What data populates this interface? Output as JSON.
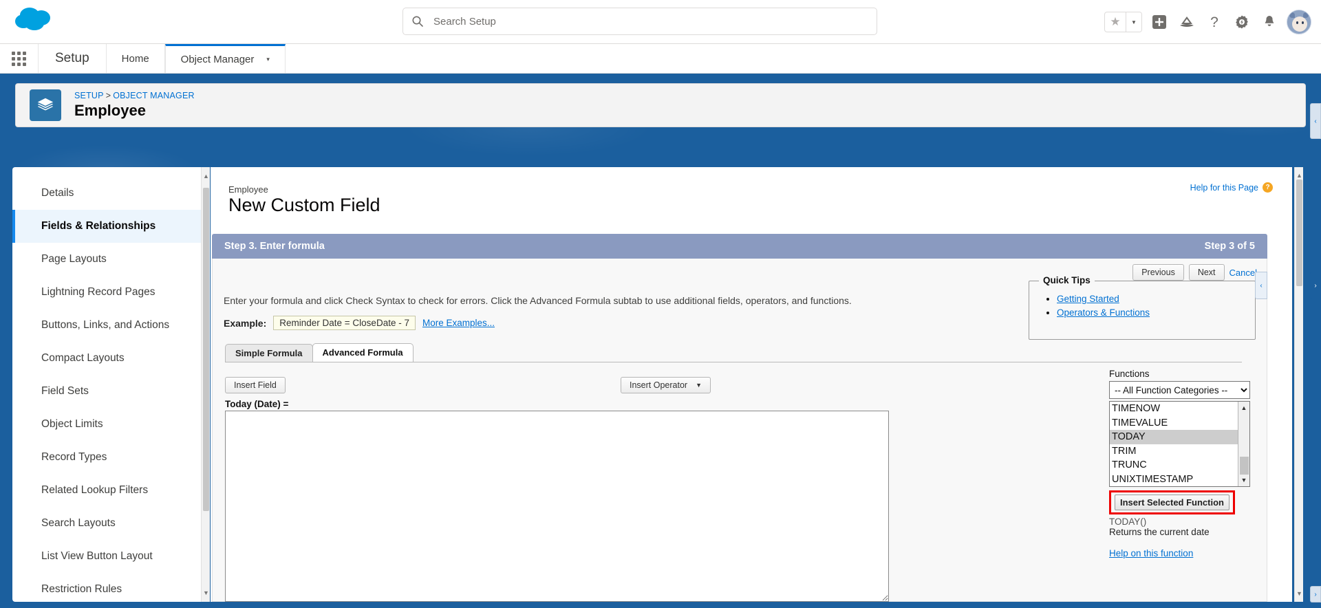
{
  "header": {
    "logo_alt": "salesforce-cloud-logo",
    "search": {
      "placeholder": "Search Setup",
      "value": ""
    },
    "actions": [
      {
        "name": "favorites-star",
        "glyph": "★"
      },
      {
        "name": "favorites-caret",
        "glyph": "▼"
      },
      {
        "name": "global-add",
        "glyph": "+"
      },
      {
        "name": "trailhead",
        "glyph": "⛰"
      },
      {
        "name": "help",
        "glyph": "?"
      },
      {
        "name": "setup-gear",
        "glyph": "⚙"
      },
      {
        "name": "notifications-bell",
        "glyph": "🔔"
      },
      {
        "name": "user-avatar",
        "glyph": ""
      }
    ]
  },
  "setup_nav": {
    "app_title": "Setup",
    "tabs": [
      {
        "label": "Home",
        "active": false
      },
      {
        "label": "Object Manager",
        "active": true,
        "caret": "▾"
      }
    ]
  },
  "record_header": {
    "breadcrumb": {
      "setup": "SETUP",
      "separator": ">",
      "object_manager": "OBJECT MANAGER"
    },
    "title": "Employee"
  },
  "sidebar": {
    "items": [
      {
        "label": "Details",
        "active": false
      },
      {
        "label": "Fields & Relationships",
        "active": true
      },
      {
        "label": "Page Layouts",
        "active": false
      },
      {
        "label": "Lightning Record Pages",
        "active": false
      },
      {
        "label": "Buttons, Links, and Actions",
        "active": false
      },
      {
        "label": "Compact Layouts",
        "active": false
      },
      {
        "label": "Field Sets",
        "active": false
      },
      {
        "label": "Object Limits",
        "active": false
      },
      {
        "label": "Record Types",
        "active": false
      },
      {
        "label": "Related Lookup Filters",
        "active": false
      },
      {
        "label": "Search Layouts",
        "active": false
      },
      {
        "label": "List View Button Layout",
        "active": false
      },
      {
        "label": "Restriction Rules",
        "active": false
      }
    ]
  },
  "main": {
    "eyebrow": "Employee",
    "title": "New Custom Field",
    "help_for_page": "Help for this Page",
    "help_badge": "?",
    "step": {
      "title": "Step 3. Enter formula",
      "counter": "Step 3 of 5"
    },
    "buttons": {
      "previous": "Previous",
      "next": "Next",
      "cancel": "Cancel"
    },
    "instruction": "Enter your formula and click Check Syntax to check for errors. Click the Advanced Formula subtab to use additional fields, operators, and functions.",
    "example": {
      "label": "Example:",
      "value": "Reminder Date = CloseDate - 7",
      "more_link": "More Examples..."
    },
    "quick_tips": {
      "legend": "Quick Tips",
      "links": [
        "Getting Started",
        "Operators & Functions"
      ]
    },
    "formula_tabs": [
      {
        "label": "Simple Formula",
        "active": false
      },
      {
        "label": "Advanced Formula",
        "active": true
      }
    ],
    "insert_field_button": "Insert Field",
    "insert_operator_button": "Insert Operator",
    "insert_operator_caret": "▼",
    "formula_field_label": "Today (Date) =",
    "formula_value": "",
    "functions": {
      "label": "Functions",
      "category_selected": "-- All Function Categories --",
      "options": [
        {
          "label": "TIMENOW",
          "selected": false
        },
        {
          "label": "TIMEVALUE",
          "selected": false
        },
        {
          "label": "TODAY",
          "selected": true
        },
        {
          "label": "TRIM",
          "selected": false
        },
        {
          "label": "TRUNC",
          "selected": false
        },
        {
          "label": "UNIXTIMESTAMP",
          "selected": false
        }
      ],
      "insert_button": "Insert Selected Function",
      "signature": "TODAY()",
      "description": "Returns the current date",
      "help_link": "Help on this function"
    }
  },
  "colors": {
    "brand_blue": "#1b5f9e",
    "link_blue": "#0070d2",
    "step_bar": "#8a9ac0",
    "highlight_red": "#ee0000",
    "active_nav": "#1589ee"
  }
}
